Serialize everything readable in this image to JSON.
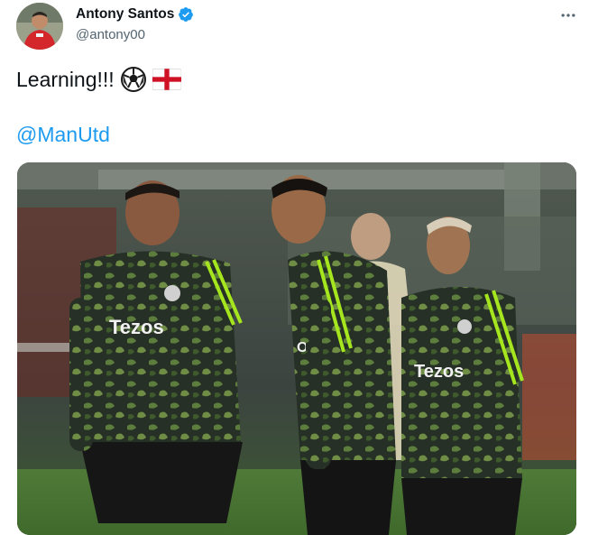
{
  "author": {
    "name": "Antony Santos",
    "handle": "@antony00",
    "avatar_icon": "avatar-photo",
    "verified_icon": "verified-badge-icon"
  },
  "tweet": {
    "text": "Learning!!!",
    "emojis": [
      "soccer-ball-icon",
      "england-flag-icon"
    ],
    "mention": "@ManUtd"
  },
  "media": {
    "kind": "photo",
    "jersey_sponsor": "Tezos"
  },
  "colors": {
    "link": "#1d9bf0",
    "verified": "#1d9bf0",
    "secondary_text": "#536471"
  }
}
